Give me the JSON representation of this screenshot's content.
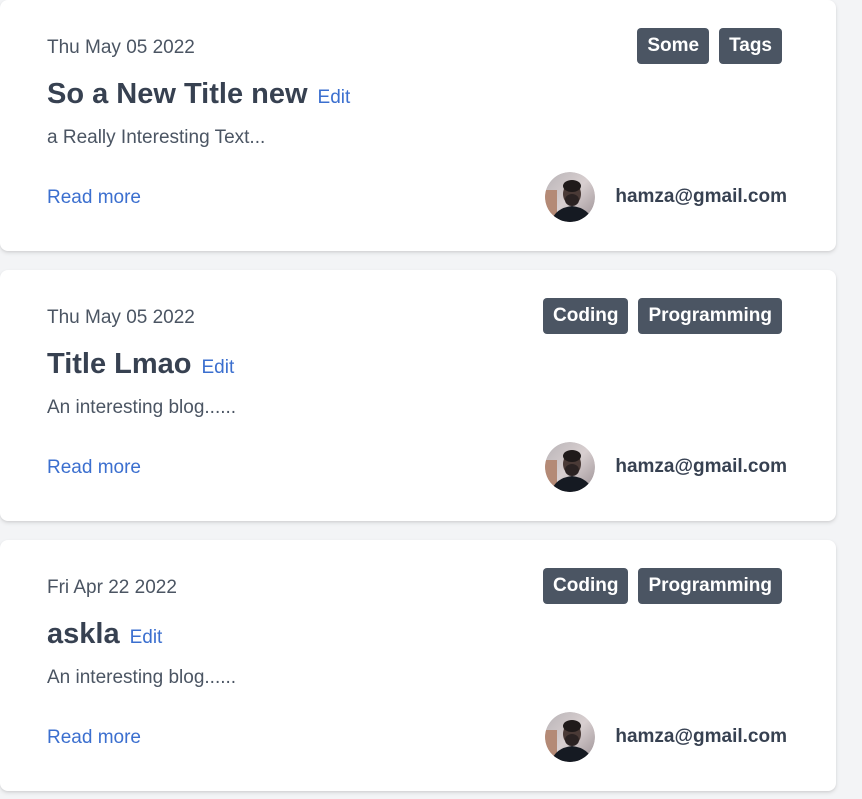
{
  "posts": [
    {
      "date": "Thu May 05 2022",
      "tags": [
        "Some",
        "Tags"
      ],
      "title": "So a New Title new",
      "edit_label": "Edit",
      "excerpt": "a Really Interesting Text...",
      "read_more_label": "Read more",
      "author_email": "hamza@gmail.com"
    },
    {
      "date": "Thu May 05 2022",
      "tags": [
        "Coding",
        "Programming"
      ],
      "title": "Title Lmao",
      "edit_label": "Edit",
      "excerpt": "An interesting blog......",
      "read_more_label": "Read more",
      "author_email": "hamza@gmail.com"
    },
    {
      "date": "Fri Apr 22 2022",
      "tags": [
        "Coding",
        "Programming"
      ],
      "title": "askla",
      "edit_label": "Edit",
      "excerpt": "An interesting blog......",
      "read_more_label": "Read more",
      "author_email": "hamza@gmail.com"
    }
  ],
  "colors": {
    "tag_bg": "#4b5563",
    "link": "#3b6fcf",
    "title": "#374151",
    "page_bg": "#f3f4f6",
    "card_bg": "#ffffff"
  },
  "icons": {
    "avatar": "user-avatar-photo"
  }
}
